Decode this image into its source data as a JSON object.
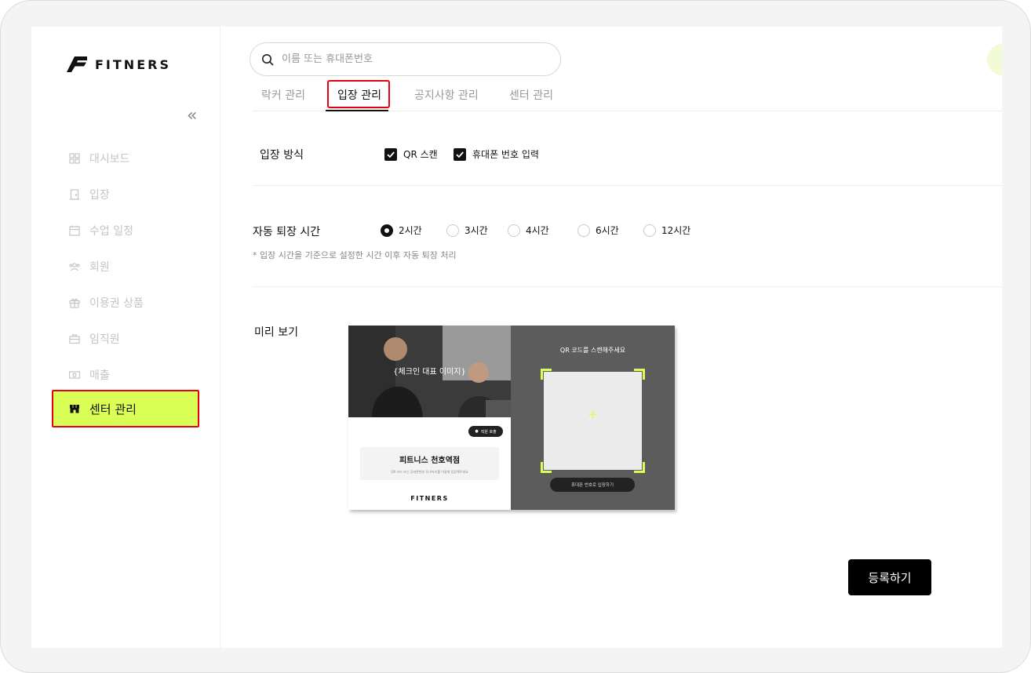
{
  "brand": {
    "logo_text": "FITNERS"
  },
  "sidebar": {
    "items": [
      {
        "label": "대시보드"
      },
      {
        "label": "입장"
      },
      {
        "label": "수업 일정"
      },
      {
        "label": "회원"
      },
      {
        "label": "이용권 상품"
      },
      {
        "label": "임직원"
      },
      {
        "label": "매출"
      },
      {
        "label": "센터 관리"
      }
    ],
    "active_index": 7
  },
  "search": {
    "placeholder": "이름 또는 휴대폰번호"
  },
  "tabs": [
    {
      "label": "락커 관리"
    },
    {
      "label": "입장 관리"
    },
    {
      "label": "공지사항 관리"
    },
    {
      "label": "센터 관리"
    }
  ],
  "entry_method": {
    "label": "입장 방식",
    "options": [
      {
        "label": "QR 스캔",
        "checked": true
      },
      {
        "label": "휴대폰 번호 입력",
        "checked": true
      }
    ]
  },
  "auto_exit": {
    "label": "자동 퇴장 시간",
    "options": [
      {
        "label": "2시간",
        "selected": true
      },
      {
        "label": "3시간",
        "selected": false
      },
      {
        "label": "4시간",
        "selected": false
      },
      {
        "label": "6시간",
        "selected": false
      },
      {
        "label": "12시간",
        "selected": false
      }
    ],
    "note": "* 입장 시간을 기준으로 설정한 시간 이후 자동 퇴장 처리"
  },
  "preview": {
    "label": "미리 보기",
    "photo_label": "{체크인 대표 이미지}",
    "staff_button": "직원 호출",
    "center_name": "피트니스 천호역점",
    "center_sub": "QR 코드 또는 휴대폰번호 뒤 4자리를 이용해 입장해주세요",
    "logo": "FITNERS",
    "qr_title": "QR 코드를 스캔해주세요",
    "phone_button": "휴대폰 번호로 입장하기"
  },
  "submit_label": "등록하기",
  "colors": {
    "accent": "#d9ff57",
    "highlight_border": "#e60012",
    "dark": "#111111"
  }
}
